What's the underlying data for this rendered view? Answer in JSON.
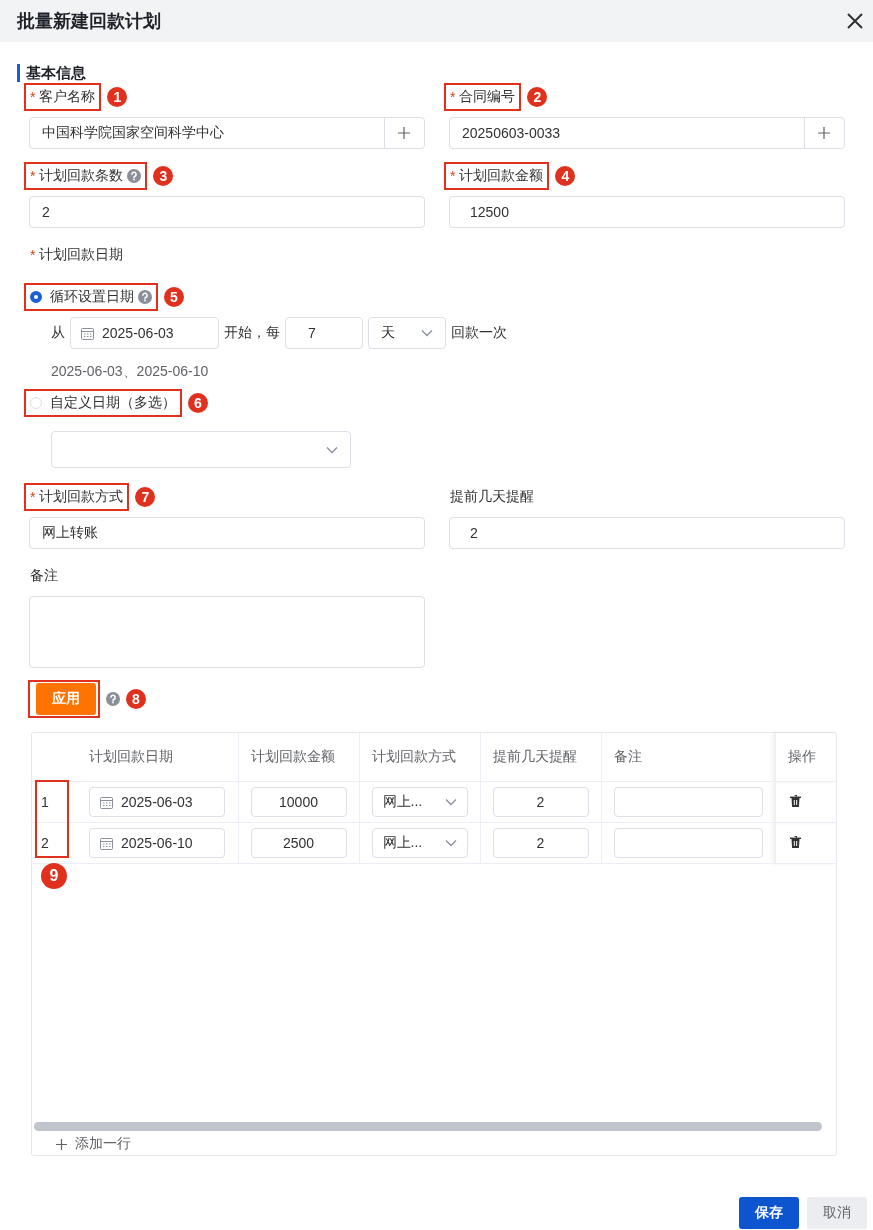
{
  "dialog": {
    "title": "批量新建回款计划"
  },
  "section": {
    "title": "基本信息"
  },
  "top_fields": [
    {
      "label": "客户名称",
      "required_mark": "*",
      "callout": "1",
      "help": false,
      "value": "中国科学院国家空间科学中心",
      "kind": "add"
    },
    {
      "label": "合同编号",
      "required_mark": "*",
      "callout": "2",
      "help": false,
      "value": "20250603-0033",
      "kind": "add"
    },
    {
      "label": "计划回款条数",
      "required_mark": "*",
      "callout": "3",
      "help": true,
      "value": "2",
      "kind": "text"
    },
    {
      "label": "计划回款金额",
      "required_mark": "*",
      "callout": "4",
      "help": false,
      "value": "12500",
      "kind": "number"
    }
  ],
  "date_rule": {
    "label": "计划回款日期",
    "required_mark": "*",
    "options": [
      {
        "label": "循环设置日期",
        "selected": true,
        "help": true,
        "callout": "5"
      },
      {
        "label": "自定义日期（多选）",
        "selected": false,
        "help": false,
        "callout": "6"
      }
    ],
    "recurrence": {
      "from": "从",
      "start_date": "2025-06-03",
      "start_text": "开始，每",
      "interval": "7",
      "unit": "天",
      "end_text": "回款一次",
      "preview": "2025-06-03、2025-06-10"
    }
  },
  "bottom_fields": [
    {
      "label": "计划回款方式",
      "required_mark": "*",
      "callout": "7",
      "help": false,
      "value": "网上转账",
      "kind": "text"
    },
    {
      "label": "提前几天提醒",
      "help": false,
      "value": "2",
      "kind": "number"
    },
    {
      "label": "备注",
      "help": false,
      "kind": "textarea"
    }
  ],
  "apply": {
    "label": "应用",
    "help": true,
    "callout": "8"
  },
  "table": {
    "columns": [
      "计划回款日期",
      "计划回款金额",
      "计划回款方式",
      "提前几天提醒",
      "备注",
      "操作"
    ],
    "rows": [
      {
        "index": "1",
        "date": "2025-06-03",
        "amount": "10000",
        "method": "网上...",
        "remind": "2"
      },
      {
        "index": "2",
        "date": "2025-06-10",
        "amount": "2500",
        "method": "网上...",
        "remind": "2"
      }
    ],
    "index_callout": "9",
    "add_row": "添加一行"
  },
  "footer": {
    "buttons": [
      {
        "label": "保存",
        "kind": "primary"
      },
      {
        "label": "取消",
        "kind": "secondary"
      }
    ]
  }
}
